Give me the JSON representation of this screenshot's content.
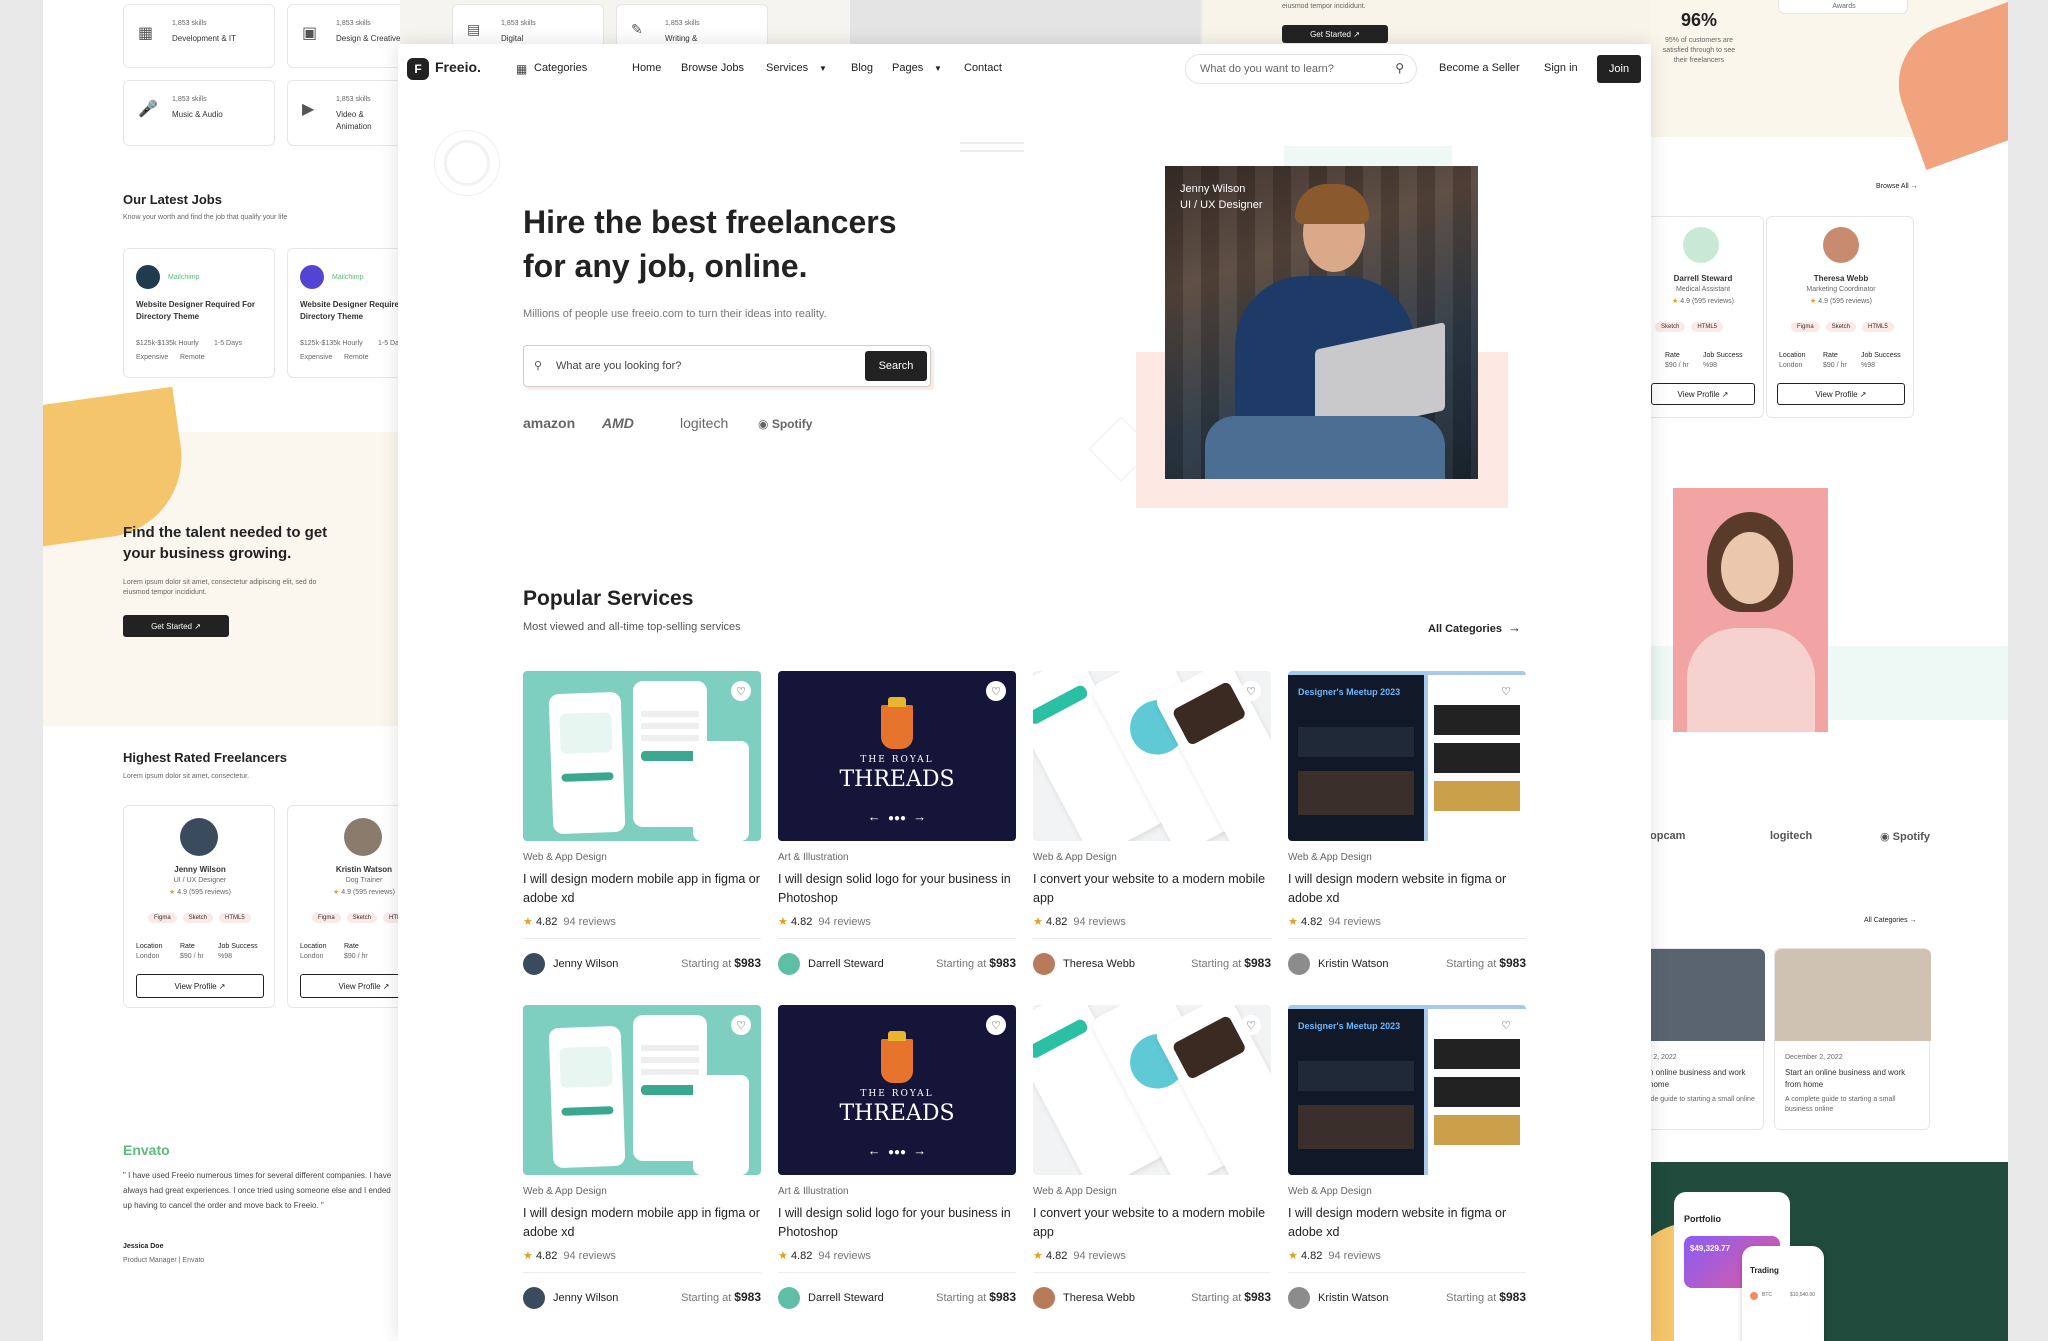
{
  "nav": {
    "logo": "Freeio.",
    "categories": "Categories",
    "links": [
      "Home",
      "Browse Jobs",
      "Services",
      "Blog",
      "Pages",
      "Contact"
    ],
    "search_placeholder": "What do you want to learn?",
    "seller": "Become a Seller",
    "signin": "Sign in",
    "join": "Join"
  },
  "hero": {
    "title": "Hire the best freelancers for any job, online.",
    "subtitle": "Millions of people use freeio.com to turn their ideas into reality.",
    "search_placeholder": "What are you looking for?",
    "search_button": "Search",
    "brands": [
      "amazon",
      "AMD",
      "logitech",
      "Spotify"
    ],
    "person_name": "Jenny Wilson",
    "person_role": "UI / UX Designer"
  },
  "popular": {
    "title": "Popular Services",
    "subtitle": "Most viewed and all-time top-selling services",
    "all_link": "All Categories",
    "starting": "Starting at",
    "services": [
      {
        "category": "Web & App Design",
        "title": "I will design modern mobile app in figma or adobe xd",
        "rating": "4.82",
        "reviews": "94 reviews",
        "author": "Jenny Wilson",
        "price": "$983"
      },
      {
        "category": "Art & Illustration",
        "title": "I will design solid logo for your business in Photoshop",
        "rating": "4.82",
        "reviews": "94 reviews",
        "author": "Darrell Steward",
        "price": "$983"
      },
      {
        "category": "Web & App Design",
        "title": "I convert your website to a modern mobile app",
        "rating": "4.82",
        "reviews": "94 reviews",
        "author": "Theresa Webb",
        "price": "$983"
      },
      {
        "category": "Web & App Design",
        "title": "I will design modern website in figma or adobe xd",
        "rating": "4.82",
        "reviews": "94 reviews",
        "author": "Kristin Watson",
        "price": "$983"
      },
      {
        "category": "Web & App Design",
        "title": "I will design modern mobile app in figma or adobe xd",
        "rating": "4.82",
        "reviews": "94 reviews",
        "author": "Jenny Wilson",
        "price": "$983"
      },
      {
        "category": "Art & Illustration",
        "title": "I will design solid logo for your business in Photoshop",
        "rating": "4.82",
        "reviews": "94 reviews",
        "author": "Darrell Steward",
        "price": "$983"
      },
      {
        "category": "Web & App Design",
        "title": "I convert your website to a modern mobile app",
        "rating": "4.82",
        "reviews": "94 reviews",
        "author": "Theresa Webb",
        "price": "$983"
      },
      {
        "category": "Web & App Design",
        "title": "I will design modern website in figma or adobe xd",
        "rating": "4.82",
        "reviews": "94 reviews",
        "author": "Kristin Watson",
        "price": "$983"
      }
    ],
    "threads_top": "THE ROYAL",
    "threads_main": "THREADS",
    "meetup_title": "Designer's Meetup 2023"
  },
  "left": {
    "skills": [
      {
        "count": "1,853 skills",
        "name": "Development & IT"
      },
      {
        "count": "1,853 skills",
        "name": "Design & Creative"
      },
      {
        "count": "1,853 skills",
        "name": "Digital"
      },
      {
        "count": "1,853 skills",
        "name": "Writing &"
      },
      {
        "count": "1,853 skills",
        "name": "Music & Audio"
      },
      {
        "count": "1,853 skills",
        "name": "Video & Animation"
      }
    ],
    "jobs_title": "Our Latest Jobs",
    "jobs_sub": "Know your worth and find the job that qualify your life",
    "jobs": [
      {
        "company": "Mailchimp",
        "title": "Website Designer Required For Directory Theme",
        "meta1": "$125k-$135k Hourly",
        "meta2": "1-5 Days",
        "tag1": "Expensive",
        "tag2": "Remote"
      },
      {
        "company": "Mailchimp",
        "title": "Website Designer Required For Directory Theme",
        "meta1": "$125k-$135k Hourly",
        "meta2": "1-5 Days",
        "tag1": "Expensive",
        "tag2": "Remote"
      }
    ],
    "talent_title": "Find the talent needed to get your business growing.",
    "talent_sub": "Lorem ipsum dolor sit amet, consectetur adipiscing elit, sed do eiusmod tempor incididunt.",
    "talent_btn": "Get Started",
    "rated_title": "Highest Rated Freelancers",
    "rated_sub": "Lorem ipsum dolor sit amet, consectetur.",
    "freelancers": [
      {
        "name": "Jenny Wilson",
        "role": "UI / UX Designer",
        "rating": "4.9",
        "reviews": "(595 reviews)",
        "loc": "London",
        "rate": "$90 / hr",
        "success": "%98"
      },
      {
        "name": "Kristin Watson",
        "role": "Dog Trainer",
        "rating": "4.9",
        "reviews": "(595 reviews)",
        "loc": "London",
        "rate": "$90 / hr",
        "success": "%98"
      }
    ],
    "tags": [
      "Figma",
      "Sketch",
      "HTML5"
    ],
    "col_labels": [
      "Location",
      "Rate",
      "Job Success"
    ],
    "view_profile": "View Profile",
    "testimonial_brand": "Envato",
    "testimonial": "\" I have used Freeio numerous times for several different companies. I have always had great experiences. I once tried using someone else and I ended up having to cancel the order and move back to Freeio. \"",
    "testimonial_name": "Jessica Doe",
    "testimonial_role": "Product Manager | Envato"
  },
  "right": {
    "stat": "96%",
    "stat_sub": "95% of customers are satisfied through to see their freelancers",
    "awards": "Awards",
    "top_text": "eiusmod tempor incididunt.",
    "top_btn": "Get Started",
    "browse_all": "Browse All",
    "freelancers": [
      {
        "name": "Darrell Steward",
        "role": "Medical Assistant",
        "rating": "4.9",
        "reviews": "(595 reviews)",
        "loc": "London",
        "rate": "$90 / hr",
        "success": "%98"
      },
      {
        "name": "Theresa Webb",
        "role": "Marketing Coordinator",
        "rating": "4.9",
        "reviews": "(595 reviews)",
        "loc": "London",
        "rate": "$90 / hr",
        "success": "%98"
      }
    ],
    "brands": [
      "opcam",
      "logitech",
      "Spotify"
    ],
    "all_categories": "All Categories",
    "blog": [
      {
        "date": "r 2, 2022",
        "title": "n online business and work home",
        "text": "ide guide to starting a small online"
      },
      {
        "date": "December 2, 2022",
        "title": "Start an online business and work from home",
        "text": "A complete guide to starting a small business online"
      }
    ],
    "portfolio": "Portfolio",
    "portfolio_value": "$49,329.77",
    "trading": "Trading",
    "btc": "BTC",
    "btc_value": "$10,540.00"
  },
  "colors": {
    "accent": "#5bbb7b",
    "dark": "#222222",
    "pink": "#fde8e4",
    "mint": "#7ecfc0"
  }
}
